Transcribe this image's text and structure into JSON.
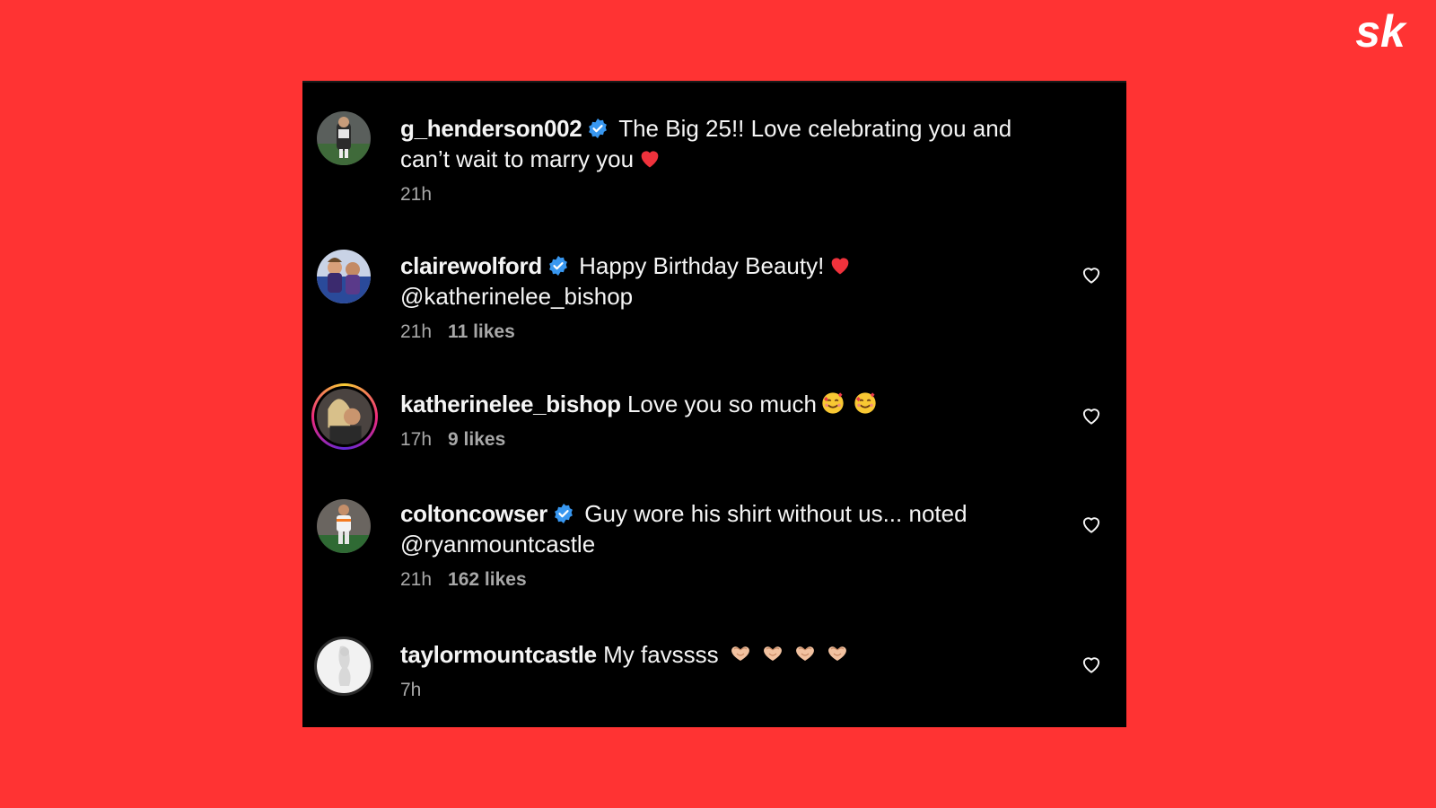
{
  "brand": {
    "logo_text": "sk",
    "background_color": "#ff3333",
    "panel_color": "#000000"
  },
  "comments": [
    {
      "username": "g_henderson002",
      "verified": true,
      "text": "The Big 25!! Love celebrating you and can’t wait to marry you",
      "emoji": "red-heart",
      "time": "21h",
      "likes": "",
      "has_like_button": false
    },
    {
      "username": "clairewolford",
      "verified": true,
      "text": "Happy Birthday Beauty!",
      "text_after_emoji": "@katherinelee_bishop",
      "emoji": "red-heart",
      "time": "21h",
      "likes": "11 likes",
      "has_like_button": true
    },
    {
      "username": "katherinelee_bishop",
      "verified": false,
      "text": "Love you so much",
      "emoji": "smiling-face-with-hearts",
      "time": "17h",
      "likes": "9 likes",
      "has_like_button": true
    },
    {
      "username": "coltoncowser",
      "verified": true,
      "text": "Guy wore his shirt without us... noted @ryanmountcastle",
      "time": "21h",
      "likes": "162 likes",
      "has_like_button": true
    },
    {
      "username": "taylormountcastle",
      "verified": false,
      "text": "My favssss",
      "emoji": "heart-hands",
      "time": "7h",
      "likes": "",
      "has_like_button": true
    }
  ]
}
